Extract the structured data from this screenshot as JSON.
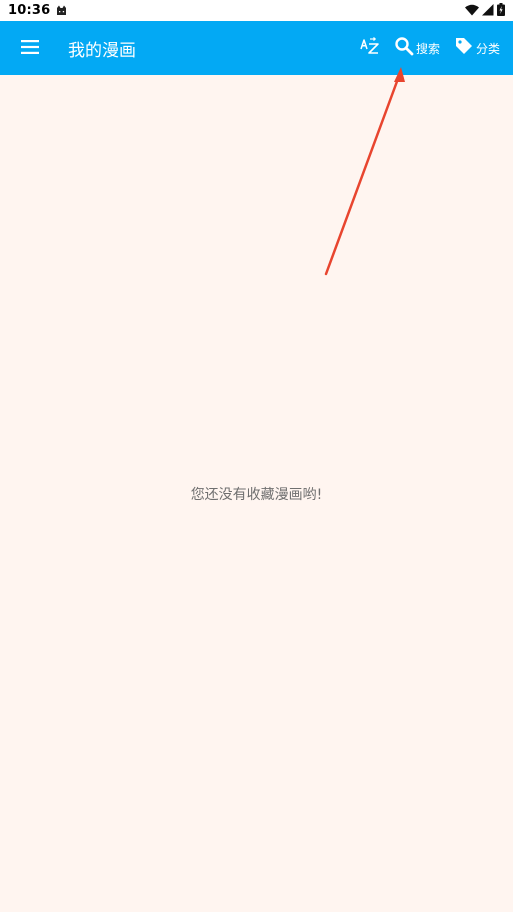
{
  "status_bar": {
    "time": "10:36",
    "icons": [
      "cat-notification-icon",
      "wifi-icon",
      "cellular-signal-icon",
      "battery-icon"
    ]
  },
  "app_bar": {
    "title": "我的漫画",
    "background_color": "#03a9f4",
    "actions": {
      "sort_icon": "sort-az-icon",
      "search_label": "搜索",
      "search_icon": "search-icon",
      "category_label": "分类",
      "category_icon": "tag-icon"
    }
  },
  "content": {
    "empty_message": "您还没有收藏漫画哟!",
    "background_color": "#fff5f0"
  },
  "annotation": {
    "type": "arrow",
    "color": "#e8452f"
  }
}
